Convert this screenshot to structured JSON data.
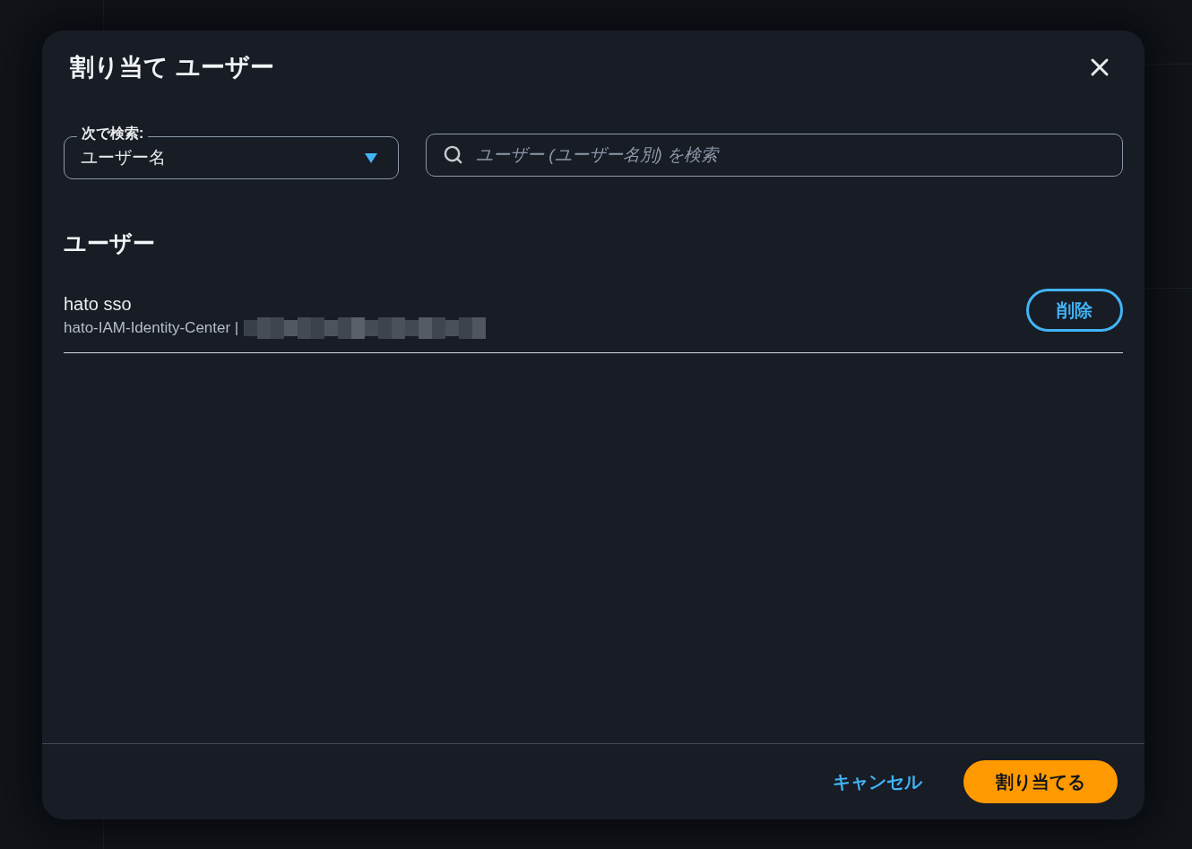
{
  "dialog": {
    "title": "割り当て ユーザー"
  },
  "search_by": {
    "label": "次で検索:",
    "value": "ユーザー名"
  },
  "search": {
    "placeholder": "ユーザー (ユーザー名別) を検索"
  },
  "section_title": "ユーザー",
  "users": [
    {
      "name": "hato sso",
      "detail": "hato-IAM-Identity-Center |",
      "redacted": true,
      "action": "削除"
    }
  ],
  "footer": {
    "buttons": [
      {
        "label": "キャンセル",
        "kind": "link"
      },
      {
        "label": "割り当てる",
        "kind": "primary"
      }
    ]
  }
}
